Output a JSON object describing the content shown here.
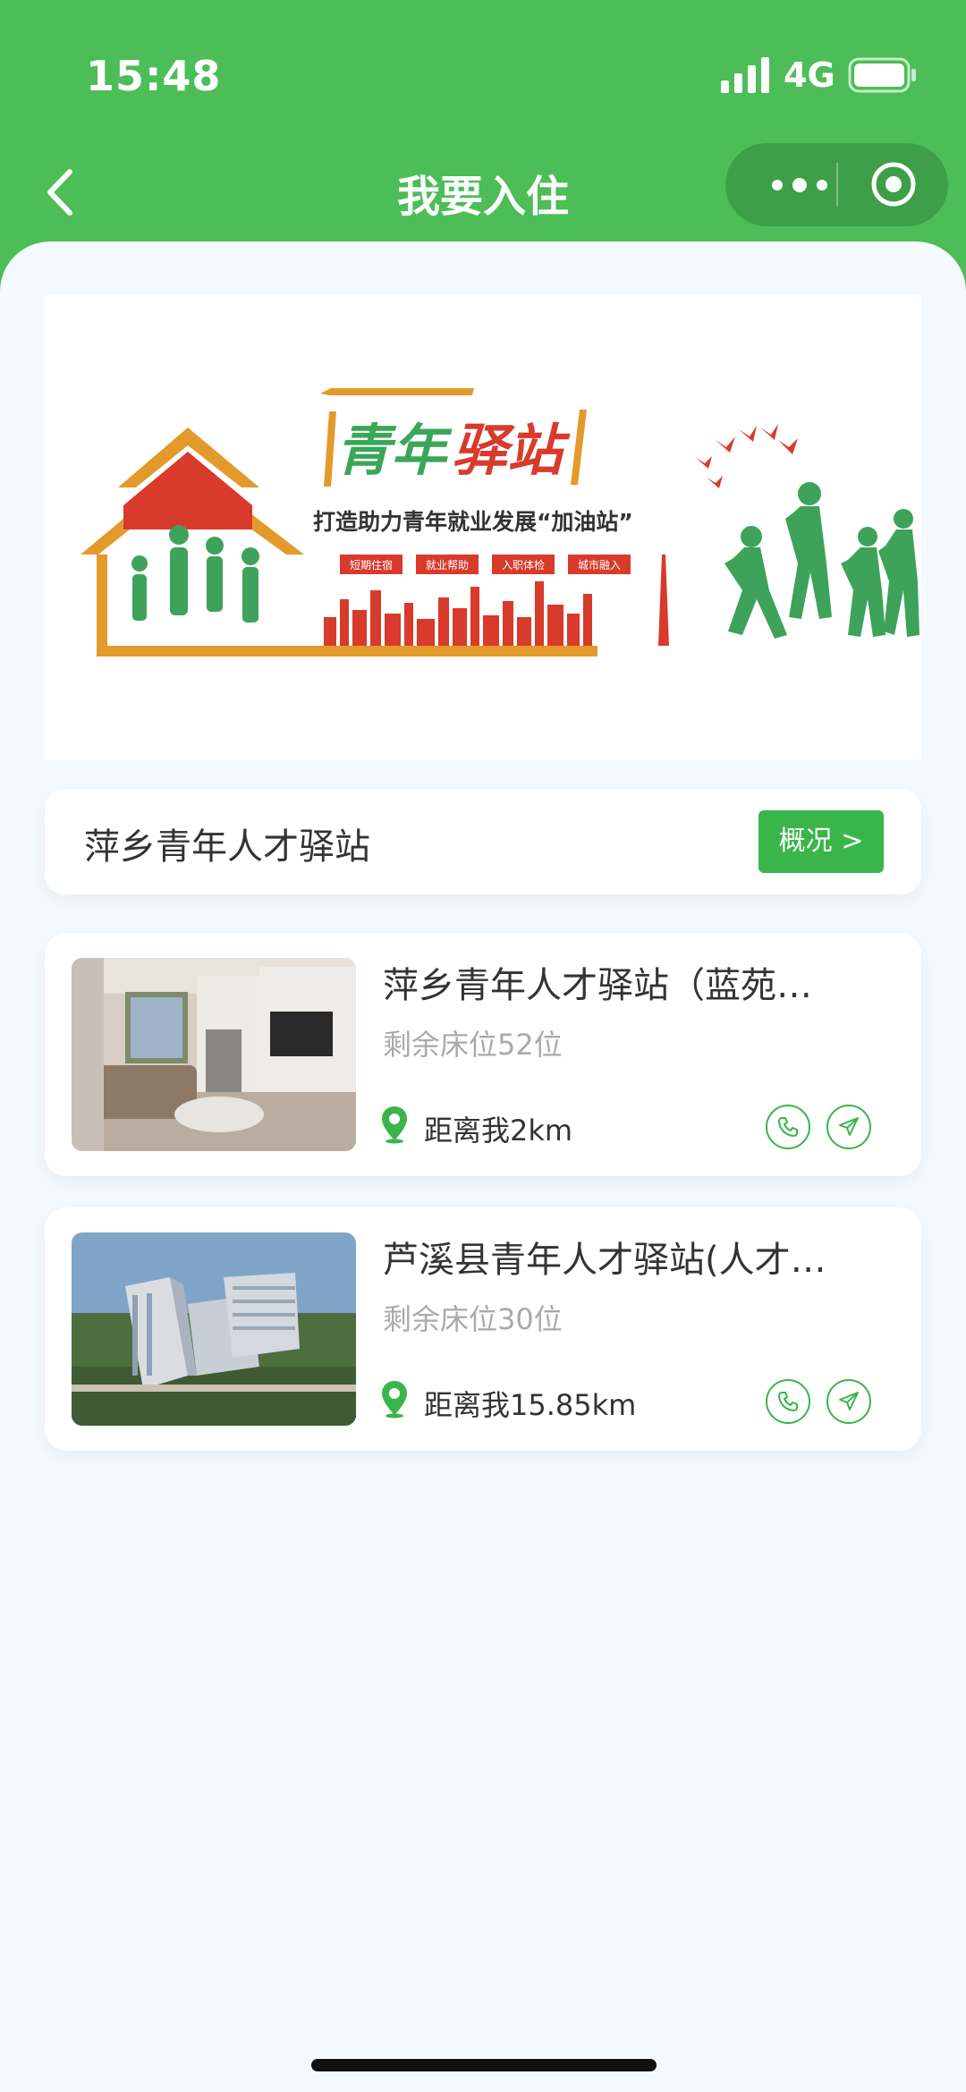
{
  "status": {
    "time": "15:48",
    "network": "4G"
  },
  "nav": {
    "title": "我要入住"
  },
  "banner": {
    "title_part1": "青年",
    "title_part2": "驿站",
    "slogan": "打造助力青年就业发展“加油站”",
    "tags": [
      "短期住宿",
      "就业帮助",
      "入职体检",
      "城市融入"
    ]
  },
  "station": {
    "name": "萍乡青年人才驿站",
    "overview_label": "概况 >"
  },
  "listings": [
    {
      "title": "萍乡青年人才驿站（蓝苑…",
      "beds": "剩余床位52位",
      "distance": "距离我2km"
    },
    {
      "title": "芦溪县青年人才驿站(人才…",
      "beds": "剩余床位30位",
      "distance": "距离我15.85km"
    }
  ],
  "colors": {
    "brand_green": "#4cbd57",
    "button_green": "#39b54a",
    "banner_orange": "#e39a2b",
    "banner_red": "#d83a2c"
  },
  "icons": {
    "back": "chevron-left-icon",
    "more": "more-dots-icon",
    "close": "target-circle-icon",
    "location": "location-pin-icon",
    "phone": "phone-icon",
    "navigate": "send-arrow-icon"
  }
}
